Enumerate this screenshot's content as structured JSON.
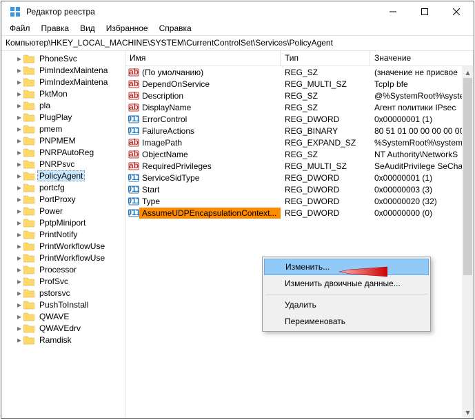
{
  "window": {
    "title": "Редактор реестра"
  },
  "menu": {
    "file": "Файл",
    "edit": "Правка",
    "view": "Вид",
    "favorites": "Избранное",
    "help": "Справка"
  },
  "address": "Компьютер\\HKEY_LOCAL_MACHINE\\SYSTEM\\CurrentControlSet\\Services\\PolicyAgent",
  "columns": {
    "name": "Имя",
    "type": "Тип",
    "value": "Значение"
  },
  "tree": [
    "PhoneSvc",
    "PimIndexMaintena",
    "PimIndexMaintena",
    "PktMon",
    "pla",
    "PlugPlay",
    "pmem",
    "PNPMEM",
    "PNRPAutoReg",
    "PNRPsvc",
    "PolicyAgent",
    "portcfg",
    "PortProxy",
    "Power",
    "PptpMiniport",
    "PrintNotify",
    "PrintWorkflowUse",
    "PrintWorkflowUse",
    "Processor",
    "ProfSvc",
    "pstorsvc",
    "PushToInstall",
    "QWAVE",
    "QWAVEdrv",
    "Ramdisk"
  ],
  "tree_selected_index": 10,
  "values": [
    {
      "icon": "sz",
      "name": "(По умолчанию)",
      "type": "REG_SZ",
      "value": "(значение не присвое"
    },
    {
      "icon": "sz",
      "name": "DependOnService",
      "type": "REG_MULTI_SZ",
      "value": "TcpIp bfe"
    },
    {
      "icon": "sz",
      "name": "Description",
      "type": "REG_SZ",
      "value": "@%SystemRoot%\\syste"
    },
    {
      "icon": "sz",
      "name": "DisplayName",
      "type": "REG_SZ",
      "value": "Агент политики IPsec"
    },
    {
      "icon": "bin",
      "name": "ErrorControl",
      "type": "REG_DWORD",
      "value": "0x00000001 (1)"
    },
    {
      "icon": "bin",
      "name": "FailureActions",
      "type": "REG_BINARY",
      "value": "80 51 01 00 00 00 00 00 0"
    },
    {
      "icon": "sz",
      "name": "ImagePath",
      "type": "REG_EXPAND_SZ",
      "value": "%SystemRoot%\\system"
    },
    {
      "icon": "sz",
      "name": "ObjectName",
      "type": "REG_SZ",
      "value": "NT Authority\\NetworkS"
    },
    {
      "icon": "sz",
      "name": "RequiredPrivileges",
      "type": "REG_MULTI_SZ",
      "value": "SeAuditPrivilege SeCha"
    },
    {
      "icon": "bin",
      "name": "ServiceSidType",
      "type": "REG_DWORD",
      "value": "0x00000001 (1)"
    },
    {
      "icon": "bin",
      "name": "Start",
      "type": "REG_DWORD",
      "value": "0x00000003 (3)"
    },
    {
      "icon": "bin",
      "name": "Type",
      "type": "REG_DWORD",
      "value": "0x00000020 (32)"
    },
    {
      "icon": "bin",
      "name": "AssumeUDPEncapsulationContext...",
      "type": "REG_DWORD",
      "value": "0x00000000 (0)"
    }
  ],
  "values_selected_index": 12,
  "context_menu": {
    "modify": "Изменить...",
    "modify_binary": "Изменить двоичные данные...",
    "delete": "Удалить",
    "rename": "Переименовать"
  }
}
